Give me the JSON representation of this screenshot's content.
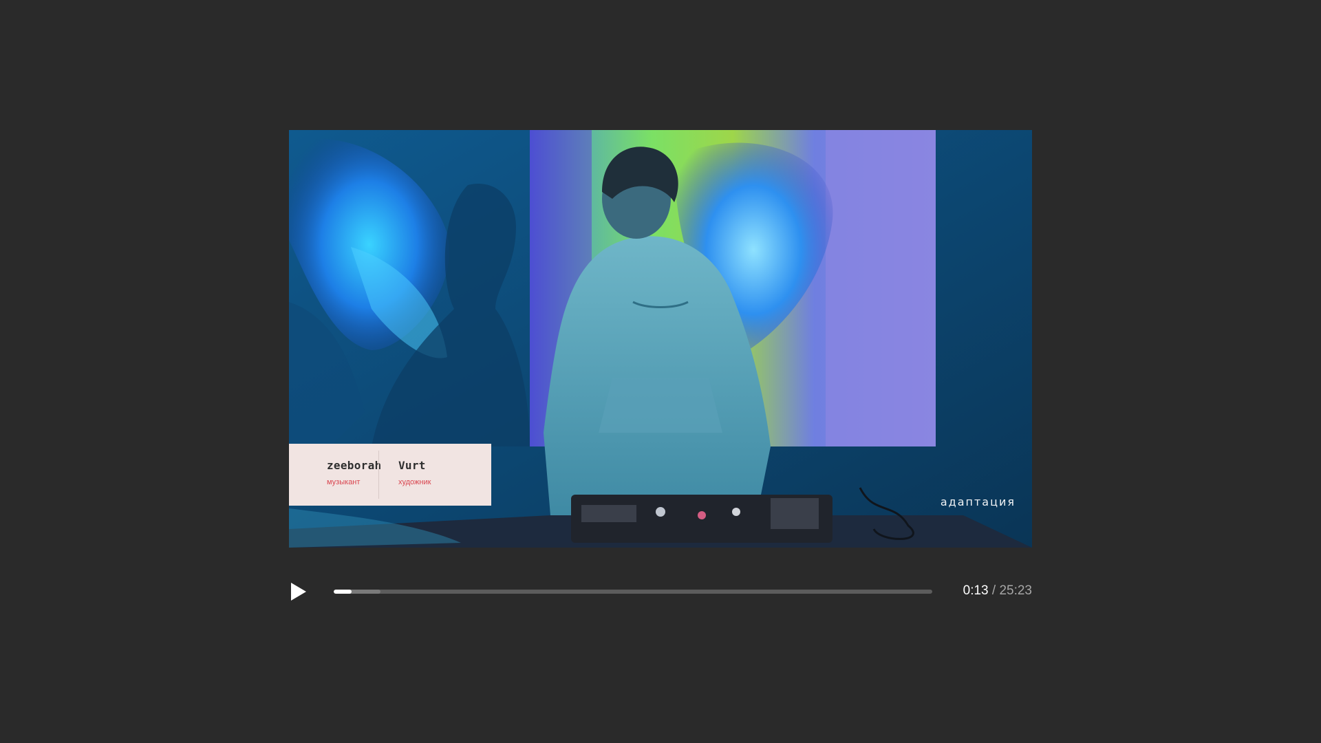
{
  "video": {
    "credits": [
      {
        "name": "zeeborah",
        "role": "музыкант"
      },
      {
        "name": "Vurt",
        "role": "художник"
      }
    ],
    "watermark": "адаптация"
  },
  "player": {
    "play_icon": "play-icon",
    "current_time": "0:13",
    "separator": "/",
    "total_time": "25:23",
    "progress_played_pct": 3,
    "progress_buffered_pct": 7.8
  },
  "colors": {
    "background": "#2a2a2a",
    "credit_card_bg": "#f1e4e2",
    "credit_role": "#d9454f",
    "progress_played": "#ffffff",
    "progress_track": "#5c5c5c"
  }
}
